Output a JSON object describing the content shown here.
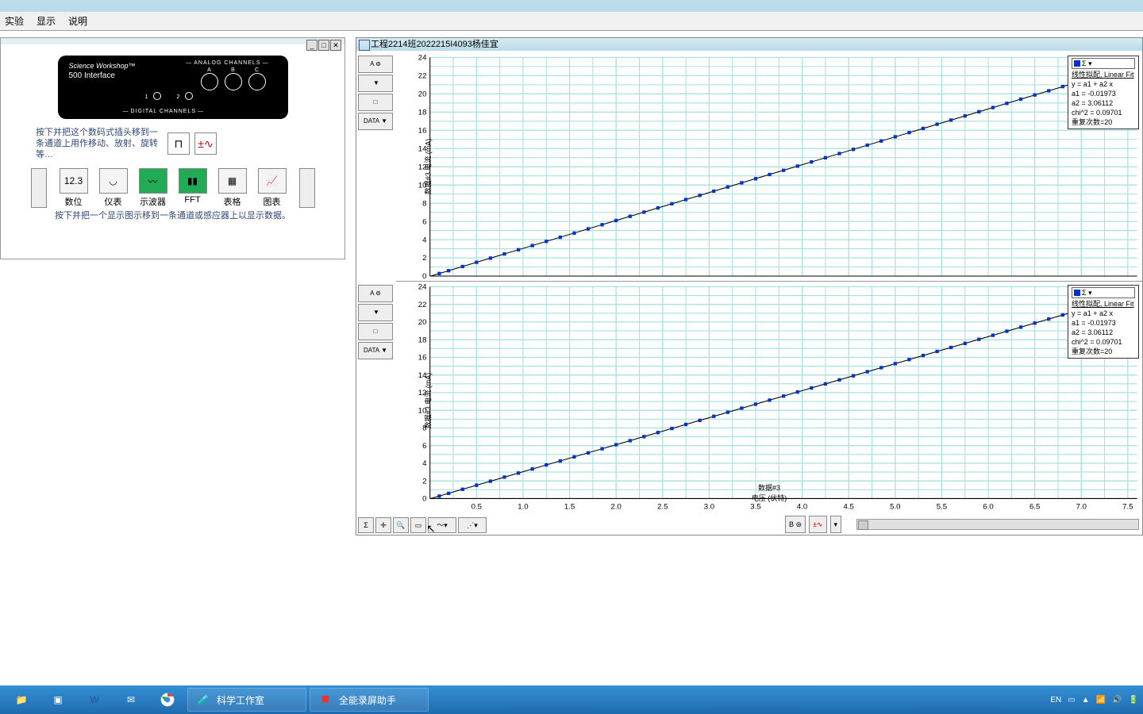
{
  "menu": {
    "experiment": "实验",
    "display": "显示",
    "help": "说明"
  },
  "interface": {
    "brand": "Science Workshop™",
    "model": "500 Interface",
    "digital": "DIGITAL CHANNELS",
    "analog": "ANALOG CHANNELS",
    "portA": "A",
    "portB": "B",
    "portC": "C",
    "ch1": "1",
    "ch2": "2"
  },
  "setup": {
    "drag_hint": "按下并把这个数码式插头移到一条通道上用作移动、放射、旋转等…",
    "disp_hint": "按下并把一个显示图示移到一条通道或感应器上以显示数据。",
    "displays": [
      {
        "label": "数位",
        "icon": "12.3"
      },
      {
        "label": "仪表",
        "icon": "◡"
      },
      {
        "label": "示波器",
        "icon": "〰"
      },
      {
        "label": "FFT",
        "icon": "▮▮"
      },
      {
        "label": "表格",
        "icon": "▦"
      },
      {
        "label": "图表",
        "icon": "📈"
      }
    ]
  },
  "graph_window_title": "工程2214班2022215I4093杨佳宜",
  "side_tool": {
    "data": "DATA"
  },
  "fit": {
    "title": "线性拟配, Linear Fit",
    "eq": "y = a1 + a2 x",
    "a1": "a1 = -0.01973",
    "a2": "a2 = 3.06112",
    "chi": "chi^2 = 0.09701",
    "rep": "重复次数=20",
    "sigma": "Σ"
  },
  "axes": {
    "x_ticks": [
      0.5,
      1.0,
      1.5,
      2.0,
      2.5,
      3.0,
      3.5,
      4.0,
      4.5,
      5.0,
      5.5,
      6.0,
      6.5,
      7.0,
      7.5
    ],
    "y_ticks": [
      0,
      2,
      4,
      6,
      8,
      10,
      12,
      14,
      16,
      18,
      20,
      22,
      24
    ],
    "x_label_top": "数据#3",
    "x_label_bot": "电压 (伏特)",
    "y_label_top": "数据#3",
    "y_label_bot": "电流 (mA)"
  },
  "chart_data": [
    {
      "type": "scatter",
      "title": "",
      "xlabel": "电压 (伏特)",
      "ylabel": "电流 (mA)",
      "xlim": [
        0,
        7.6
      ],
      "ylim": [
        0,
        24
      ],
      "series": [
        {
          "name": "数据#3",
          "x": [
            0.1,
            0.2,
            0.35,
            0.5,
            0.65,
            0.8,
            0.95,
            1.1,
            1.25,
            1.4,
            1.55,
            1.7,
            1.85,
            2.0,
            2.15,
            2.3,
            2.45,
            2.6,
            2.75,
            2.9,
            3.05,
            3.2,
            3.35,
            3.5,
            3.65,
            3.8,
            3.95,
            4.1,
            4.25,
            4.4,
            4.55,
            4.7,
            4.85,
            5.0,
            5.15,
            5.3,
            5.45,
            5.6,
            5.75,
            5.9,
            6.05,
            6.2,
            6.35,
            6.5,
            6.65,
            6.8,
            6.95,
            7.1,
            7.25,
            7.4
          ],
          "y": [
            0.28,
            0.59,
            1.05,
            1.51,
            1.97,
            2.43,
            2.89,
            3.35,
            3.81,
            4.26,
            4.72,
            5.18,
            5.64,
            6.1,
            6.56,
            7.02,
            7.48,
            7.94,
            8.4,
            8.86,
            9.32,
            9.78,
            10.24,
            10.69,
            11.15,
            11.61,
            12.07,
            12.53,
            12.99,
            13.45,
            13.91,
            14.37,
            14.83,
            15.29,
            15.75,
            16.21,
            16.67,
            17.12,
            17.58,
            18.04,
            18.5,
            18.96,
            19.42,
            19.88,
            20.34,
            20.8,
            21.26,
            21.72,
            22.18,
            22.63
          ]
        }
      ],
      "fit": {
        "type": "linear",
        "a1": -0.01973,
        "a2": 3.06112,
        "chi2": 0.09701,
        "n": 20
      }
    },
    {
      "type": "scatter",
      "title": "",
      "xlabel": "电压 (伏特)",
      "ylabel": "电流 (mA)",
      "xlim": [
        0,
        7.6
      ],
      "ylim": [
        0,
        24
      ],
      "series": [
        {
          "name": "数据#3",
          "x": [
            0.1,
            0.2,
            0.35,
            0.5,
            0.65,
            0.8,
            0.95,
            1.1,
            1.25,
            1.4,
            1.55,
            1.7,
            1.85,
            2.0,
            2.15,
            2.3,
            2.45,
            2.6,
            2.75,
            2.9,
            3.05,
            3.2,
            3.35,
            3.5,
            3.65,
            3.8,
            3.95,
            4.1,
            4.25,
            4.4,
            4.55,
            4.7,
            4.85,
            5.0,
            5.15,
            5.3,
            5.45,
            5.6,
            5.75,
            5.9,
            6.05,
            6.2,
            6.35,
            6.5,
            6.65,
            6.8,
            6.95,
            7.1,
            7.25,
            7.4
          ],
          "y": [
            0.28,
            0.59,
            1.05,
            1.51,
            1.97,
            2.43,
            2.89,
            3.35,
            3.81,
            4.26,
            4.72,
            5.18,
            5.64,
            6.1,
            6.56,
            7.02,
            7.48,
            7.94,
            8.4,
            8.86,
            9.32,
            9.78,
            10.24,
            10.69,
            11.15,
            11.61,
            12.07,
            12.53,
            12.99,
            13.45,
            13.91,
            14.37,
            14.83,
            15.29,
            15.75,
            16.21,
            16.67,
            17.12,
            17.58,
            18.04,
            18.5,
            18.96,
            19.42,
            19.88,
            20.34,
            20.8,
            21.26,
            21.72,
            22.18,
            22.63
          ]
        }
      ],
      "fit": {
        "type": "linear",
        "a1": -0.01973,
        "a2": 3.06112,
        "chi2": 0.09701,
        "n": 20
      }
    }
  ],
  "taskbar": {
    "app1": "科学工作室",
    "app2": "全能录屏助手",
    "lang": "EN"
  }
}
